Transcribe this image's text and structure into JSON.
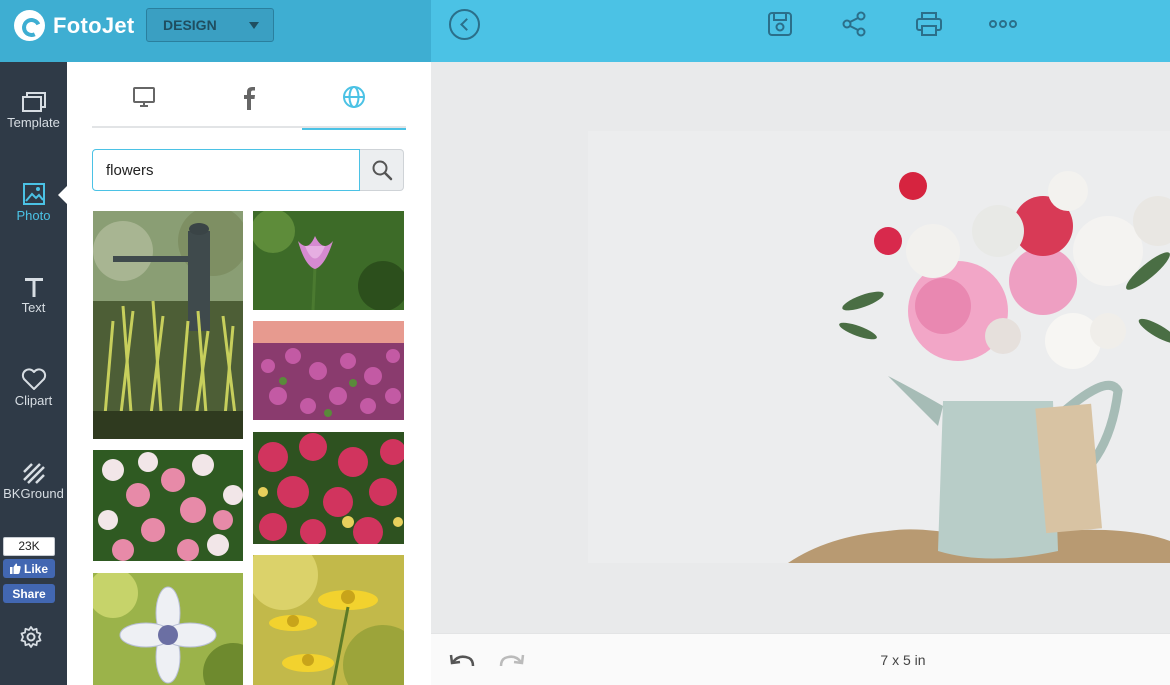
{
  "app": {
    "logo_text": "FotoJet",
    "mode": "DESIGN",
    "brand_color": "#4bc2e5"
  },
  "toolbar": {
    "icons": [
      "back-icon",
      "save-icon",
      "share-icon",
      "print-icon",
      "more-icon"
    ]
  },
  "rail": {
    "items": [
      {
        "label": "Template",
        "icon": "template-icon"
      },
      {
        "label": "Photo",
        "icon": "photo-icon",
        "active": true
      },
      {
        "label": "Text",
        "icon": "text-icon"
      },
      {
        "label": "Clipart",
        "icon": "heart-icon"
      },
      {
        "label": "BKGround",
        "icon": "background-icon"
      }
    ],
    "facebook": {
      "count": "23K",
      "like": "Like",
      "share": "Share"
    }
  },
  "panel": {
    "tabs": [
      {
        "icon": "computer-icon"
      },
      {
        "icon": "facebook-icon"
      },
      {
        "icon": "globe-icon",
        "active": true
      }
    ],
    "search": {
      "value": "flowers",
      "placeholder": ""
    },
    "thumbnails": [
      "statue-with-grass",
      "pink-tulip",
      "pink-heather",
      "white-pink-roses",
      "red-chrysanthemums",
      "white-nigella-flower",
      "yellow-daisies"
    ]
  },
  "canvas": {
    "size_label": "7 x 5 in",
    "photo": "flowers-in-jug"
  }
}
